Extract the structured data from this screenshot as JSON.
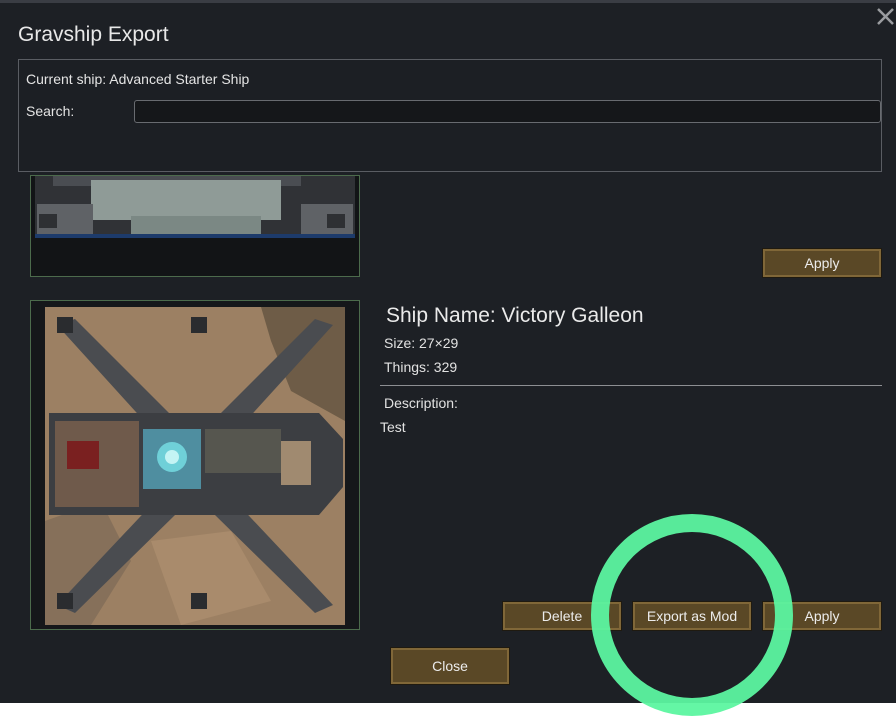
{
  "window": {
    "title": "Gravship Export",
    "close_icon": "close-x-icon"
  },
  "info": {
    "current_ship": "Current ship: Advanced Starter Ship",
    "search_label": "Search:",
    "search_value": ""
  },
  "ships": [
    {
      "apply_label": "Apply"
    },
    {
      "name": "Ship Name: Victory Galleon",
      "size": "Size: 27×29",
      "things": "Things: 329",
      "description_label": "Description:",
      "description": "Test",
      "delete_label": "Delete",
      "export_label": "Export as Mod",
      "apply_label": "Apply"
    }
  ],
  "footer": {
    "close_label": "Close"
  },
  "colors": {
    "background": "#1d2025",
    "button": "#5a4826",
    "preview_border": "#4c6b4c",
    "highlight": "#5cf5a0"
  }
}
